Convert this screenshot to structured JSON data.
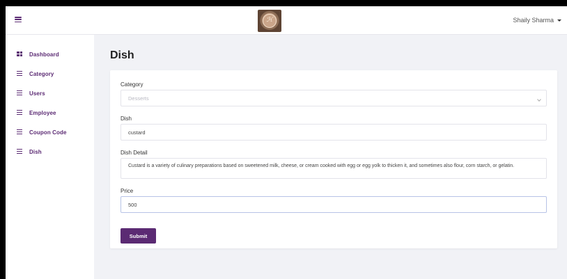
{
  "header": {
    "user_name": "Shaily Sharma"
  },
  "sidebar": {
    "items": [
      {
        "label": "Dashboard",
        "icon": "dashboard-grid-icon"
      },
      {
        "label": "Category",
        "icon": "list-icon"
      },
      {
        "label": "Users",
        "icon": "list-icon"
      },
      {
        "label": "Employee",
        "icon": "list-icon"
      },
      {
        "label": "Coupon Code",
        "icon": "list-icon"
      },
      {
        "label": "Dish",
        "icon": "list-icon"
      }
    ]
  },
  "page": {
    "title": "Dish"
  },
  "form": {
    "category_label": "Category",
    "category_value": "Desserts",
    "dish_label": "Dish",
    "dish_value": "custard",
    "detail_label": "Dish Detail",
    "detail_value": "Custard is a variety of culinary preparations based on sweetened milk, cheese, or cream cooked with egg or egg yolk to thicken it, and sometimes also flour, corn starch, or gelatin.",
    "price_label": "Price",
    "price_value": "500",
    "submit_label": "Submit"
  },
  "colors": {
    "brand": "#5b2a73",
    "background": "#f1f2f6"
  }
}
